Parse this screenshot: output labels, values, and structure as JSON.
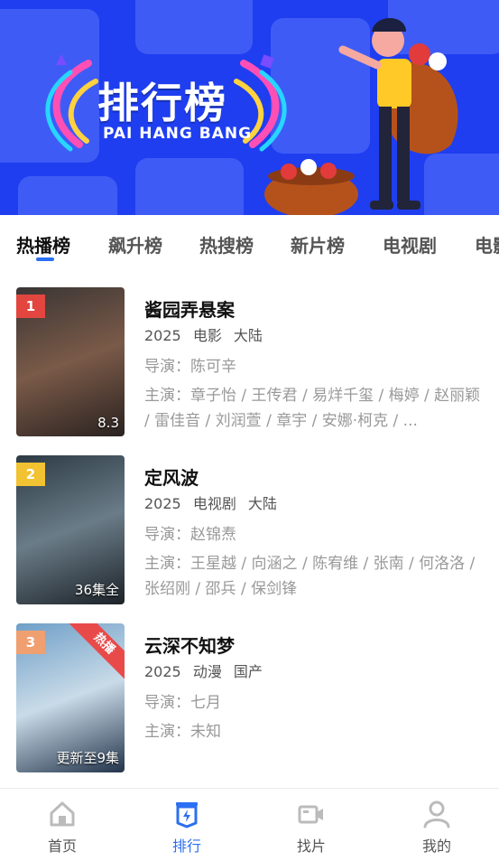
{
  "banner": {
    "title": "排行榜",
    "subtitle": "PAI HANG BANG"
  },
  "tabs": [
    {
      "label": "热播榜",
      "active": true
    },
    {
      "label": "飙升榜",
      "active": false
    },
    {
      "label": "热搜榜",
      "active": false
    },
    {
      "label": "新片榜",
      "active": false
    },
    {
      "label": "电视剧",
      "active": false
    },
    {
      "label": "电影",
      "active": false
    }
  ],
  "items": [
    {
      "rank": "1",
      "rank_color": "#e2463f",
      "title": "酱园弄悬案",
      "year": "2025",
      "type": "电影",
      "region": "大陆",
      "director": "导演：陈可辛",
      "cast": "主演：章子怡 / 王传君 / 易烊千玺 / 梅婷 / 赵丽颖 / 雷佳音 / 刘润萱 / 章宇 / 安娜·柯克 / ...",
      "poster_caption": "8.3",
      "poster_colors": [
        "#3a3534",
        "#7a5a48",
        "#2a2220"
      ]
    },
    {
      "rank": "2",
      "rank_color": "#f1c232",
      "title": "定风波",
      "year": "2025",
      "type": "电视剧",
      "region": "大陆",
      "director": "导演：赵锦焘",
      "cast": "主演：王星越 / 向涵之 / 陈宥维 / 张南 / 何洛洛 / 张绍刚 / 邵兵 / 保剑锋",
      "poster_caption": "36集全",
      "poster_colors": [
        "#2c3a44",
        "#6a7c88",
        "#1c2228"
      ]
    },
    {
      "rank": "3",
      "rank_color": "#f0a070",
      "title": "云深不知梦",
      "year": "2025",
      "type": "动漫",
      "region": "国产",
      "director": "导演：七月",
      "cast": "主演：未知",
      "poster_caption": "更新至9集",
      "hot_badge": "热播",
      "poster_colors": [
        "#6f9fc8",
        "#c9dbe8",
        "#22344a"
      ]
    }
  ],
  "bottom_nav": [
    {
      "label": "首页",
      "icon": "home-icon",
      "active": false
    },
    {
      "label": "排行",
      "icon": "ranking-icon",
      "active": true
    },
    {
      "label": "找片",
      "icon": "video-camera-icon",
      "active": false
    },
    {
      "label": "我的",
      "icon": "user-icon",
      "active": false
    }
  ],
  "colors": {
    "accent": "#2b6ff2",
    "banner_bg": "#1f3ef0"
  }
}
